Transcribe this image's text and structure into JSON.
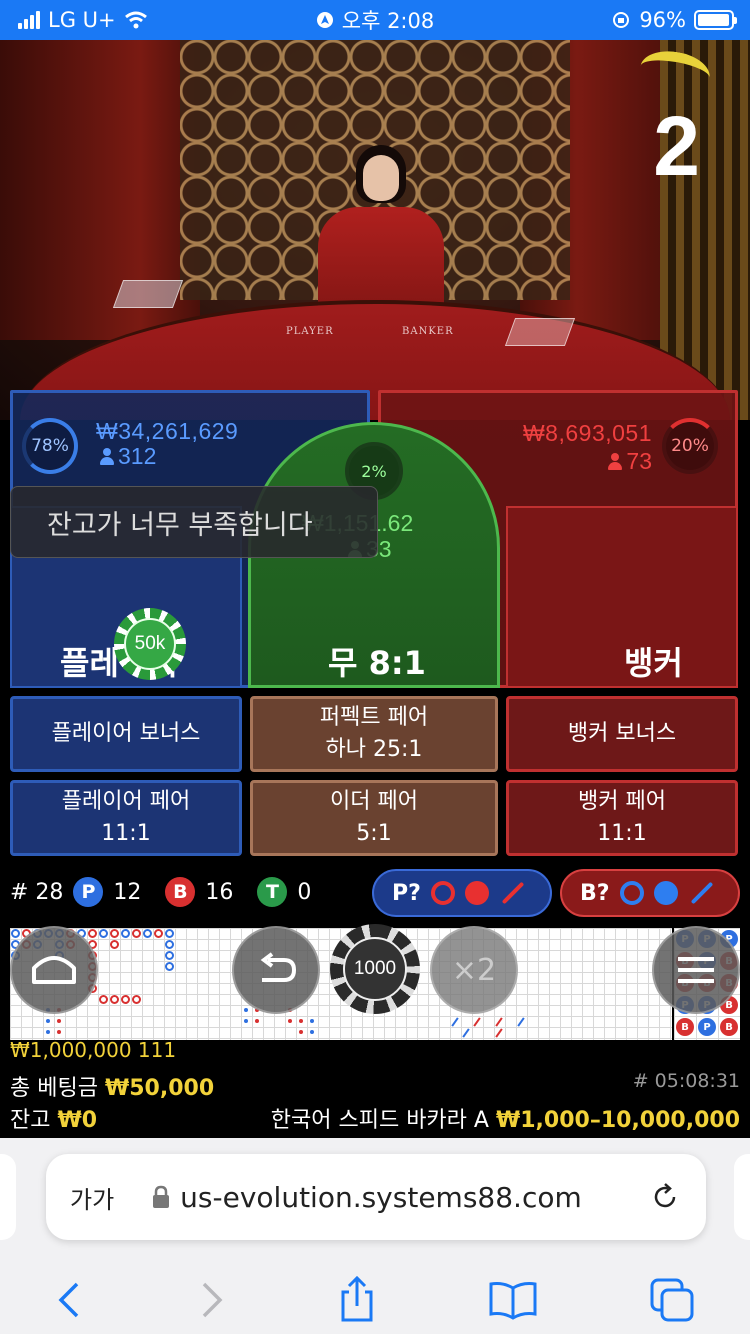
{
  "status_bar": {
    "carrier": "LG U+",
    "time": "오후 2:08",
    "battery": "96%",
    "battery_level": 0.96
  },
  "video": {
    "round_number": "2",
    "table_player": "PLAYER",
    "table_banker": "BANKER"
  },
  "player": {
    "percent": "78%",
    "amount": "₩34,261,629",
    "players": "312",
    "label": "플레이어"
  },
  "tie": {
    "percent": "2%",
    "amount": "₩1,151.62",
    "players": "33",
    "label": "무 8:1"
  },
  "banker": {
    "percent": "20%",
    "amount": "₩8,693,051",
    "players": "73",
    "label": "뱅커"
  },
  "toast": "잔고가 너무 부족합니다",
  "chip_selected": "50k",
  "side_bets": {
    "player_bonus": "플레이어 보너스",
    "perfect_pair": "퍼펙트 페어",
    "perfect_pair_odds": "하나 25:1",
    "banker_bonus": "뱅커 보너스",
    "player_pair": "플레이어 페어",
    "player_pair_odds": "11:1",
    "either_pair": "이더 페어",
    "either_pair_odds": "5:1",
    "banker_pair": "뱅커 페어",
    "banker_pair_odds": "11:1"
  },
  "stats": {
    "round": "# 28",
    "p_letter": "P",
    "p_count": "12",
    "b_letter": "B",
    "b_count": "16",
    "t_letter": "T",
    "t_count": "0"
  },
  "predict": {
    "player": "P?",
    "banker": "B?"
  },
  "controls": {
    "chip_value": "1000",
    "double": "×2"
  },
  "info": {
    "last_win": "₩1,000,000 111",
    "total_bet_label": "총 베팅금",
    "total_bet": "₩50,000",
    "game_id": "# 05:08:31",
    "balance_label": "잔고",
    "balance": "₩0",
    "table_name": "한국어 스피드 바카라 A",
    "limits": "₩1,000–10,000,000"
  },
  "safari": {
    "text_size": "가가",
    "url": "us-evolution.systems88.com"
  },
  "colors": {
    "player_blue": "#2e5cb8",
    "banker_red": "#c03030",
    "tie_green": "#4db84d",
    "gold": "#f2d23a",
    "ios_blue": "#1a79f5"
  }
}
